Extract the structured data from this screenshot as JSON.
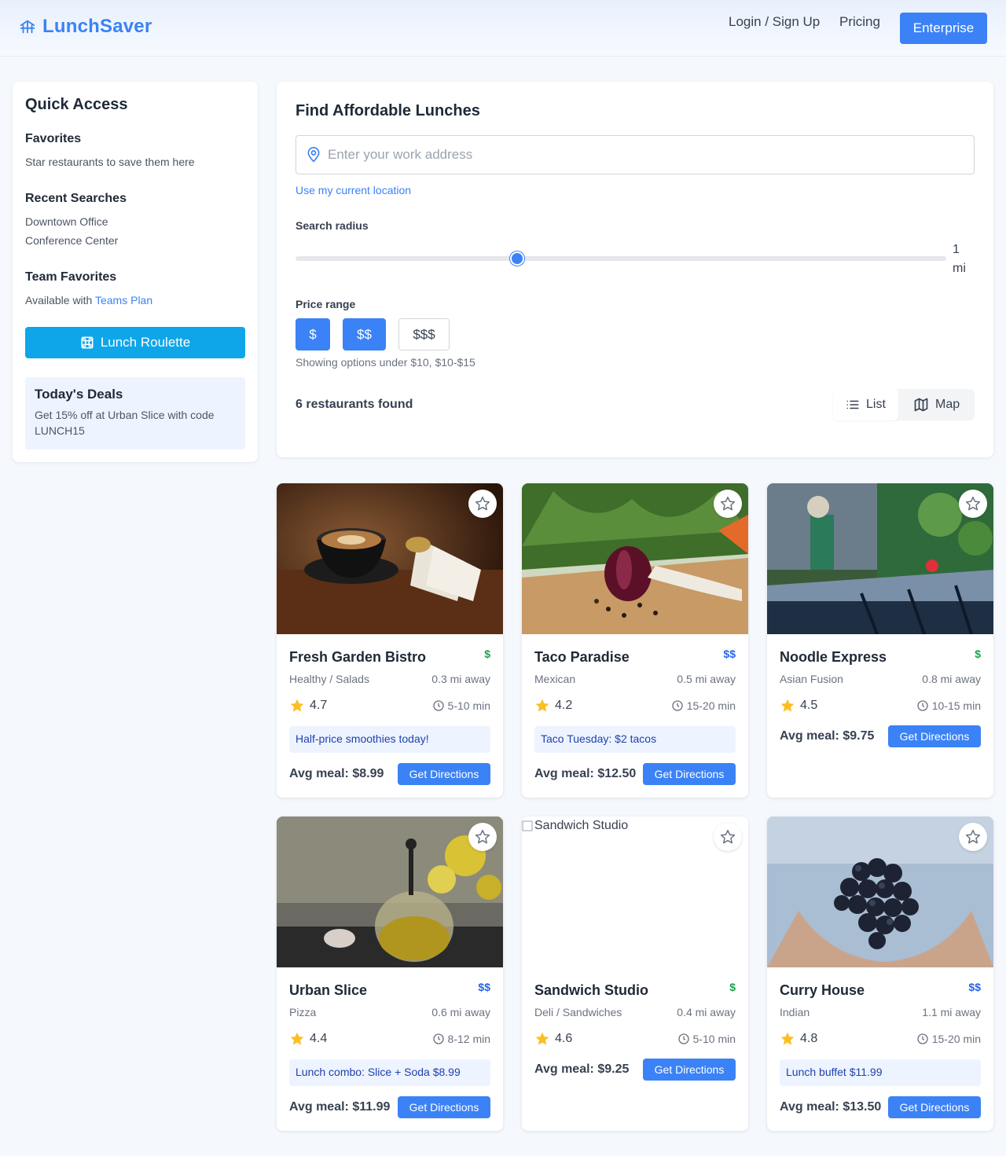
{
  "header": {
    "brand": "LunchSaver",
    "nav": {
      "login": "Login / Sign Up",
      "pricing": "Pricing",
      "enterprise": "Enterprise"
    }
  },
  "sidebar": {
    "title": "Quick Access",
    "favorites": {
      "heading": "Favorites",
      "text": "Star restaurants to save them here"
    },
    "recent": {
      "heading": "Recent Searches",
      "items": [
        "Downtown Office",
        "Conference Center"
      ]
    },
    "team": {
      "heading": "Team Favorites",
      "text": "Available with ",
      "link": "Teams Plan"
    },
    "roulette_label": "Lunch Roulette",
    "deals": {
      "heading": "Today's Deals",
      "text": "Get 15% off at Urban Slice with code LUNCH15"
    }
  },
  "search": {
    "title": "Find Affordable Lunches",
    "address": {
      "value": "",
      "placeholder": "Enter your work address"
    },
    "use_location": "Use my current location",
    "radius": {
      "label": "Search radius",
      "value": 1,
      "unit": "mi",
      "slider_fraction": 0.34
    },
    "price": {
      "label": "Price range",
      "options": [
        {
          "label": "$",
          "selected": true
        },
        {
          "label": "$$",
          "selected": true
        },
        {
          "label": "$$$",
          "selected": false
        }
      ],
      "note": "Showing options under $10, $10-$15"
    },
    "results_count": "6 restaurants found",
    "view_toggle": {
      "list": "List",
      "map": "Map",
      "active": "List"
    }
  },
  "colors": {
    "accent": "#3b82f6",
    "price_green": "#16a34a",
    "price_blue": "#2563eb",
    "star": "#fbbf24",
    "roulette": "#0ea5e9"
  },
  "restaurants": [
    {
      "name": "Fresh Garden Bistro",
      "price": "$",
      "price_color": "green",
      "cuisine": "Healthy / Salads",
      "distance": "0.3 mi away",
      "rating": "4.7",
      "time": "5-10 min",
      "deal": "Half-price smoothies today!",
      "avg": "Avg meal: $8.99",
      "cta": "Get Directions",
      "image": "coffee-cup-photo"
    },
    {
      "name": "Taco Paradise",
      "price": "$$",
      "price_color": "blue",
      "cuisine": "Mexican",
      "distance": "0.5 mi away",
      "rating": "4.2",
      "time": "15-20 min",
      "deal": "Taco Tuesday: $2 tacos",
      "avg": "Avg meal: $12.50",
      "cta": "Get Directions",
      "image": "vegetables-photo"
    },
    {
      "name": "Noodle Express",
      "price": "$",
      "price_color": "green",
      "cuisine": "Asian Fusion",
      "distance": "0.8 mi away",
      "rating": "4.5",
      "time": "10-15 min",
      "deal": "",
      "avg": "Avg meal: $9.75",
      "cta": "Get Directions",
      "image": "patio-photo"
    },
    {
      "name": "Urban Slice",
      "price": "$$",
      "price_color": "blue",
      "cuisine": "Pizza",
      "distance": "0.6 mi away",
      "rating": "4.4",
      "time": "8-12 min",
      "deal": "Lunch combo: Slice + Soda $8.99",
      "avg": "Avg meal: $11.99",
      "cta": "Get Directions",
      "image": "teapot-photo"
    },
    {
      "name": "Sandwich Studio",
      "price": "$",
      "price_color": "green",
      "cuisine": "Deli / Sandwiches",
      "distance": "0.4 mi away",
      "rating": "4.6",
      "time": "5-10 min",
      "deal": "",
      "avg": "Avg meal: $9.25",
      "cta": "Get Directions",
      "image": "broken-image",
      "image_alt": "Sandwich Studio"
    },
    {
      "name": "Curry House",
      "price": "$$",
      "price_color": "blue",
      "cuisine": "Indian",
      "distance": "1.1 mi away",
      "rating": "4.8",
      "time": "15-20 min",
      "deal": "Lunch buffet $11.99",
      "avg": "Avg meal: $13.50",
      "cta": "Get Directions",
      "image": "grapes-photo"
    }
  ]
}
